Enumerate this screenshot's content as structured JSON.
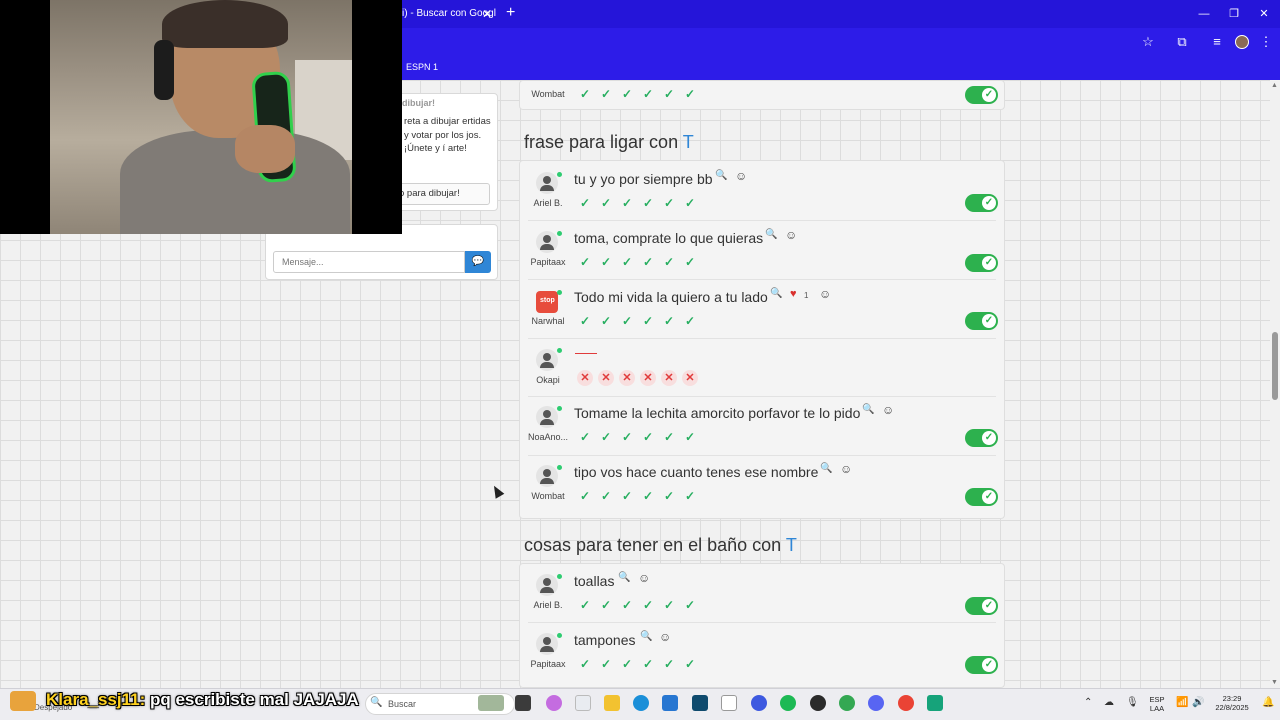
{
  "browser": {
    "tab_title": "i) - Buscar con Googl",
    "tab_close": "✕",
    "new_tab": "+",
    "window_controls": [
      "—",
      "❐",
      "✕"
    ],
    "toolbar_icons": [
      "☆",
      "⧉",
      "≡",
      "⋮"
    ],
    "bookmark": "ESPN 1"
  },
  "promo": {
    "title": "dibujar!",
    "text": "reta a dibujar ertidas y votar por los jos. ¡Únete y í arte!",
    "button": "o para dibujar!"
  },
  "chat": {
    "placeholder": "Mensaje...",
    "send_icon": "💬"
  },
  "top_row": {
    "user": "Wombat"
  },
  "sections": [
    {
      "title": "frase para ligar con",
      "letter": "T",
      "rows": [
        {
          "user": "Ariel B.",
          "answer": "tu y yo por siempre bb"
        },
        {
          "user": "Papitaax",
          "answer": "toma, comprate lo que quieras"
        },
        {
          "user": "Narwhal",
          "answer": "Todo mi vida la quiero a tu lado",
          "likes": "1",
          "avatar_text": "stop"
        },
        {
          "user": "Okapi",
          "answer": ""
        },
        {
          "user": "NoaAno...",
          "answer": "Tomame la lechita amorcito porfavor te lo pido"
        },
        {
          "user": "Wombat",
          "answer": "tipo vos hace cuanto tenes ese nombre"
        }
      ]
    },
    {
      "title": "cosas para tener en el baño con",
      "letter": "T",
      "rows": [
        {
          "user": "Ariel B.",
          "answer": "toallas"
        },
        {
          "user": "Papitaax",
          "answer": "tampones"
        }
      ]
    }
  ],
  "icons": {
    "search": "🔍",
    "emoji": "☺",
    "heart": "♥",
    "check": "✓",
    "cross": "✕"
  },
  "taskbar": {
    "search_placeholder": "Buscar",
    "weather_label": "Despejado",
    "lang": "ESP",
    "layout": "LAA",
    "time": "23:29",
    "date": "22/8/2025"
  },
  "stream_chat": {
    "user": "Klara_ssj11:",
    "message": " pq escribiste mal JAJAJA"
  },
  "colors": {
    "accent": "#2f86d6",
    "toggle_on": "#2db14e",
    "browser": "#2d1ce8",
    "error": "#e03b3b"
  }
}
